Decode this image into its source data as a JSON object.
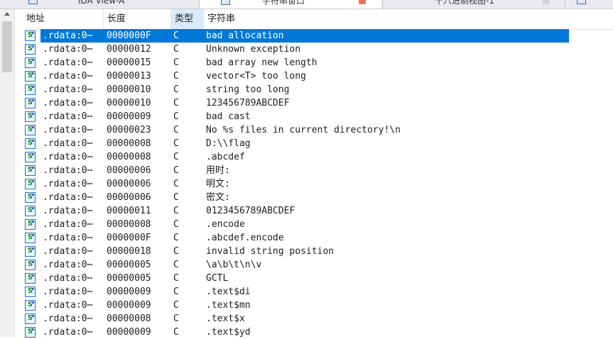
{
  "tabs": [
    {
      "label": "IDA View-A"
    },
    {
      "label": "字符串窗口"
    },
    {
      "label": "十六进制视图-1"
    }
  ],
  "columns": {
    "address": "地址",
    "length": "长度",
    "type": "类型",
    "string": "字符串"
  },
  "rows": [
    {
      "addr": ".rdata:0⋯",
      "len": "0000000F",
      "type": "C",
      "str": "bad allocation",
      "selected": true
    },
    {
      "addr": ".rdata:0⋯",
      "len": "00000012",
      "type": "C",
      "str": "Unknown exception"
    },
    {
      "addr": ".rdata:0⋯",
      "len": "00000015",
      "type": "C",
      "str": "bad array new length"
    },
    {
      "addr": ".rdata:0⋯",
      "len": "00000013",
      "type": "C",
      "str": "vector<T> too long"
    },
    {
      "addr": ".rdata:0⋯",
      "len": "00000010",
      "type": "C",
      "str": "string too long"
    },
    {
      "addr": ".rdata:0⋯",
      "len": "00000010",
      "type": "C",
      "str": "123456789ABCDEF"
    },
    {
      "addr": ".rdata:0⋯",
      "len": "00000009",
      "type": "C",
      "str": "bad cast"
    },
    {
      "addr": ".rdata:0⋯",
      "len": "00000023",
      "type": "C",
      "str": "No %s files in current directory!\\n"
    },
    {
      "addr": ".rdata:0⋯",
      "len": "00000008",
      "type": "C",
      "str": "D:\\\\flag"
    },
    {
      "addr": ".rdata:0⋯",
      "len": "00000008",
      "type": "C",
      "str": ".abcdef"
    },
    {
      "addr": ".rdata:0⋯",
      "len": "00000006",
      "type": "C",
      "str": "用时:"
    },
    {
      "addr": ".rdata:0⋯",
      "len": "00000006",
      "type": "C",
      "str": "明文:"
    },
    {
      "addr": ".rdata:0⋯",
      "len": "00000006",
      "type": "C",
      "str": "密文:"
    },
    {
      "addr": ".rdata:0⋯",
      "len": "00000011",
      "type": "C",
      "str": "0123456789ABCDEF"
    },
    {
      "addr": ".rdata:0⋯",
      "len": "00000008",
      "type": "C",
      "str": ".encode"
    },
    {
      "addr": ".rdata:0⋯",
      "len": "0000000F",
      "type": "C",
      "str": ".abcdef.encode"
    },
    {
      "addr": ".rdata:0⋯",
      "len": "00000018",
      "type": "C",
      "str": "invalid string position"
    },
    {
      "addr": ".rdata:0⋯",
      "len": "00000005",
      "type": "C",
      "str": "\\a\\b\\t\\n\\v"
    },
    {
      "addr": ".rdata:0⋯",
      "len": "00000005",
      "type": "C",
      "str": "GCTL"
    },
    {
      "addr": ".rdata:0⋯",
      "len": "00000009",
      "type": "C",
      "str": ".text$di"
    },
    {
      "addr": ".rdata:0⋯",
      "len": "00000009",
      "type": "C",
      "str": ".text$mn"
    },
    {
      "addr": ".rdata:0⋯",
      "len": "00000008",
      "type": "C",
      "str": ".text$x"
    },
    {
      "addr": ".rdata:0⋯",
      "len": "00000009",
      "type": "C",
      "str": ".text$yd"
    }
  ],
  "icon_glyph": "S",
  "colors": {
    "selection": "#0078d7",
    "sorted_header": "#d9ebfb",
    "icon_green": "#168a34",
    "tab_close_active": "#e7734f"
  },
  "icons": [
    "string-icon",
    "tab-close-icon",
    "scroll-up-icon"
  ]
}
